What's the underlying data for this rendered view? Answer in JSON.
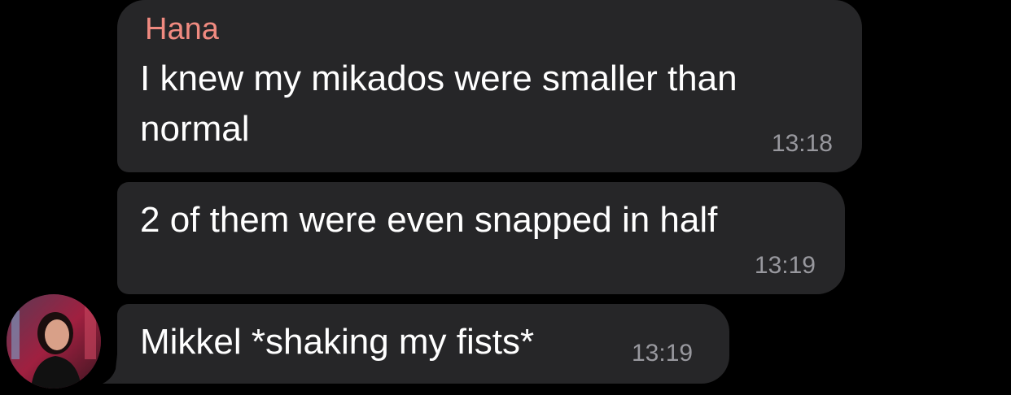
{
  "messages": [
    {
      "sender": "Hana",
      "text": "I knew my mikados were smaller than\nnormal",
      "time": "13:18"
    },
    {
      "text": "2 of them were even snapped in half",
      "time": "13:19"
    },
    {
      "text": "Mikkel *shaking my fists*",
      "time": "13:19"
    }
  ],
  "colors": {
    "background": "#000000",
    "bubble": "#262628",
    "sender_name": "#f08a80",
    "message_text": "#ffffff",
    "timestamp": "#98989e"
  },
  "icons": [
    "avatar"
  ]
}
